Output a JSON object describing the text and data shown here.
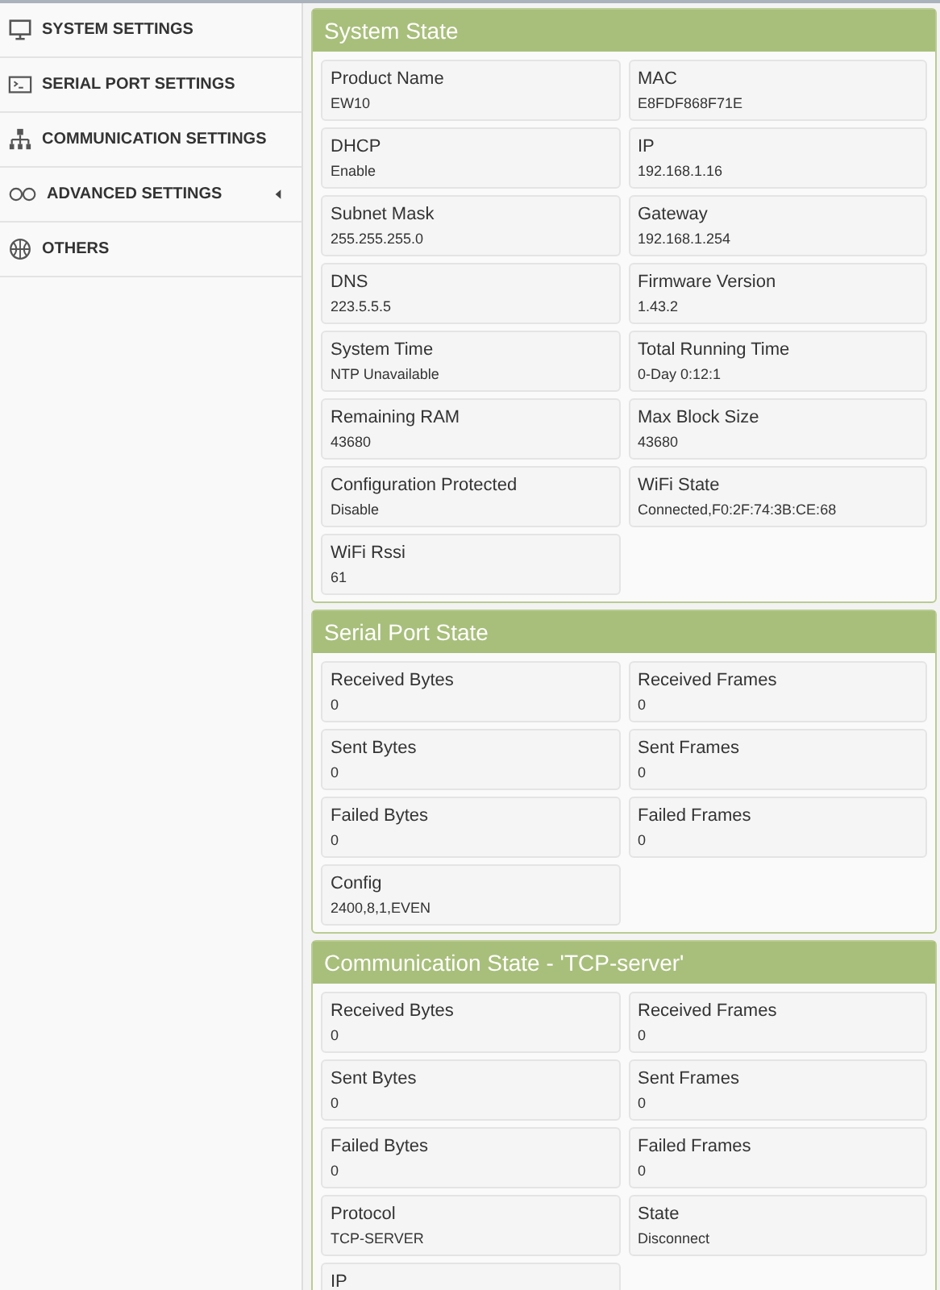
{
  "sidebar": {
    "items": [
      {
        "label": "SYSTEM SETTINGS",
        "expandable": false
      },
      {
        "label": "SERIAL PORT SETTINGS",
        "expandable": false
      },
      {
        "label": "COMMUNICATION SETTINGS",
        "expandable": false
      },
      {
        "label": "ADVANCED SETTINGS",
        "expandable": true
      },
      {
        "label": "OTHERS",
        "expandable": false
      }
    ]
  },
  "panels": [
    {
      "title": "System State",
      "fields": [
        {
          "label": "Product Name",
          "value": "EW10"
        },
        {
          "label": "MAC",
          "value": "E8FDF868F71E"
        },
        {
          "label": "DHCP",
          "value": "Enable"
        },
        {
          "label": "IP",
          "value": "192.168.1.16"
        },
        {
          "label": "Subnet Mask",
          "value": "255.255.255.0"
        },
        {
          "label": "Gateway",
          "value": "192.168.1.254"
        },
        {
          "label": "DNS",
          "value": "223.5.5.5"
        },
        {
          "label": "Firmware Version",
          "value": "1.43.2"
        },
        {
          "label": "System Time",
          "value": "NTP Unavailable"
        },
        {
          "label": "Total Running Time",
          "value": "0-Day 0:12:1"
        },
        {
          "label": "Remaining RAM",
          "value": "43680"
        },
        {
          "label": "Max Block Size",
          "value": "43680"
        },
        {
          "label": "Configuration Protected",
          "value": "Disable"
        },
        {
          "label": "WiFi State",
          "value": "Connected,F0:2F:74:3B:CE:68"
        },
        {
          "label": "WiFi Rssi",
          "value": "61"
        }
      ]
    },
    {
      "title": "Serial Port State",
      "fields": [
        {
          "label": "Received Bytes",
          "value": "0"
        },
        {
          "label": "Received Frames",
          "value": "0"
        },
        {
          "label": "Sent Bytes",
          "value": "0"
        },
        {
          "label": "Sent Frames",
          "value": "0"
        },
        {
          "label": "Failed Bytes",
          "value": "0"
        },
        {
          "label": "Failed Frames",
          "value": "0"
        },
        {
          "label": "Config",
          "value": "2400,8,1,EVEN"
        }
      ]
    },
    {
      "title": "Communication State - 'TCP-server'",
      "fields": [
        {
          "label": "Received Bytes",
          "value": "0"
        },
        {
          "label": "Received Frames",
          "value": "0"
        },
        {
          "label": "Sent Bytes",
          "value": "0"
        },
        {
          "label": "Sent Frames",
          "value": "0"
        },
        {
          "label": "Failed Bytes",
          "value": "0"
        },
        {
          "label": "Failed Frames",
          "value": "0"
        },
        {
          "label": "Protocol",
          "value": "TCP-SERVER"
        },
        {
          "label": "State",
          "value": "Disconnect"
        },
        {
          "label": "IP"
        }
      ]
    }
  ]
}
